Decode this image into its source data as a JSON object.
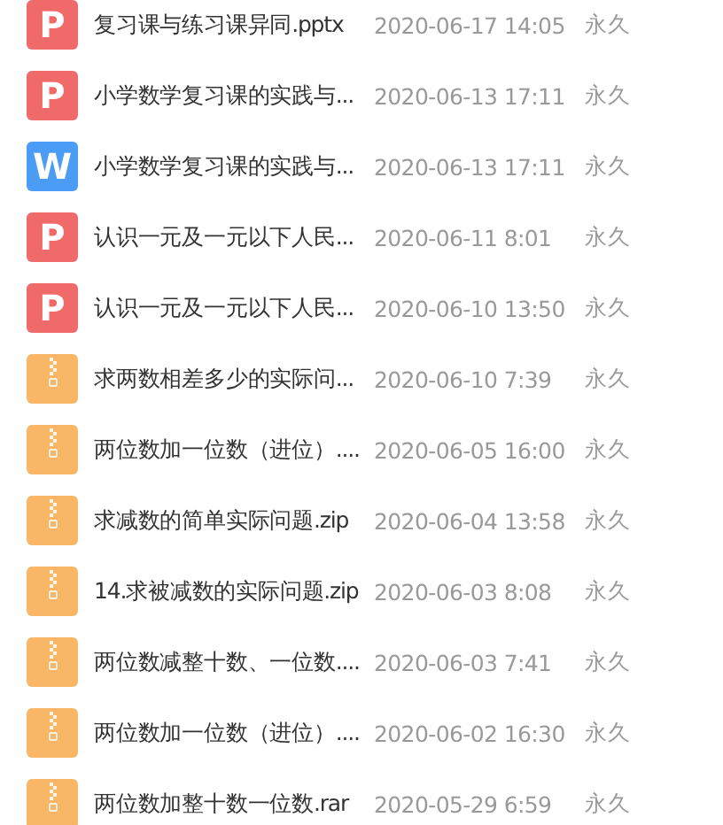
{
  "files": [
    {
      "kind": "ppt",
      "icon_letter": "P",
      "name": "复习课与练习课异同.pptx",
      "date": "2020-06-17 14:05",
      "expiry": "永久"
    },
    {
      "kind": "ppt",
      "icon_letter": "P",
      "name": "小学数学复习课的实践与...",
      "date": "2020-06-13 17:11",
      "expiry": "永久"
    },
    {
      "kind": "doc",
      "icon_letter": "W",
      "name": "小学数学复习课的实践与...",
      "date": "2020-06-13 17:11",
      "expiry": "永久"
    },
    {
      "kind": "ppt",
      "icon_letter": "P",
      "name": "认识一元及一元以下人民...",
      "date": "2020-06-11 8:01",
      "expiry": "永久"
    },
    {
      "kind": "ppt",
      "icon_letter": "P",
      "name": "认识一元及一元以下人民...",
      "date": "2020-06-10 13:50",
      "expiry": "永久"
    },
    {
      "kind": "zip",
      "name": "求两数相差多少的实际问...",
      "date": "2020-06-10 7:39",
      "expiry": "永久"
    },
    {
      "kind": "zip",
      "name": "两位数加一位数（进位）....",
      "date": "2020-06-05 16:00",
      "expiry": "永久"
    },
    {
      "kind": "zip",
      "name": "求减数的简单实际问题.zip",
      "date": "2020-06-04 13:58",
      "expiry": "永久"
    },
    {
      "kind": "zip",
      "name": "14.求被减数的实际问题.zip",
      "date": "2020-06-03 8:08",
      "expiry": "永久"
    },
    {
      "kind": "zip",
      "name": "两位数减整十数、一位数....",
      "date": "2020-06-03 7:41",
      "expiry": "永久"
    },
    {
      "kind": "zip",
      "name": "两位数加一位数（进位）....",
      "date": "2020-06-02 16:30",
      "expiry": "永久"
    },
    {
      "kind": "zip",
      "name": "两位数加整十数一位数.rar",
      "date": "2020-05-29 6:59",
      "expiry": "永久"
    }
  ]
}
